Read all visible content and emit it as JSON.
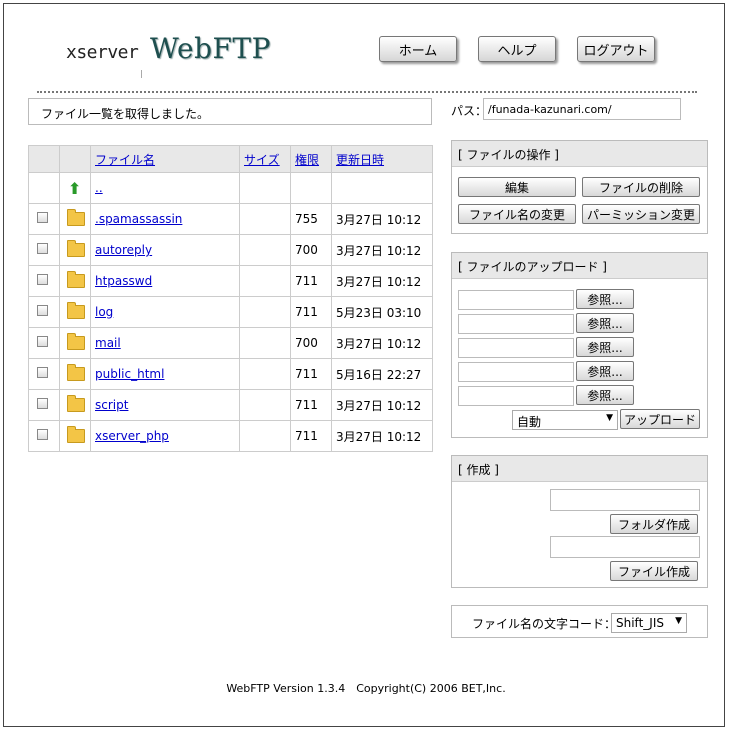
{
  "header": {
    "logo_prefix": "xserver",
    "logo_main": "WebFTP",
    "nav": [
      {
        "label": "ホーム"
      },
      {
        "label": "ヘルプ"
      },
      {
        "label": "ログアウト"
      }
    ]
  },
  "status_message": "ファイル一覧を取得しました。",
  "path": {
    "label": "パス：",
    "value": "/funada-kazunari.com/"
  },
  "file_table": {
    "columns": {
      "name": "ファイル名",
      "size": "サイズ",
      "perm": "権限",
      "date": "更新日時"
    },
    "parent": "..",
    "rows": [
      {
        "name": ".spamassassin",
        "size": "",
        "perm": "755",
        "date": "3月27日 10:12"
      },
      {
        "name": "autoreply",
        "size": "",
        "perm": "700",
        "date": "3月27日 10:12"
      },
      {
        "name": "htpasswd",
        "size": "",
        "perm": "711",
        "date": "3月27日 10:12"
      },
      {
        "name": "log",
        "size": "",
        "perm": "711",
        "date": "5月23日 03:10"
      },
      {
        "name": "mail",
        "size": "",
        "perm": "700",
        "date": "3月27日 10:12"
      },
      {
        "name": "public_html",
        "size": "",
        "perm": "711",
        "date": "5月16日 22:27"
      },
      {
        "name": "script",
        "size": "",
        "perm": "711",
        "date": "3月27日 10:12"
      },
      {
        "name": "xserver_php",
        "size": "",
        "perm": "711",
        "date": "3月27日 10:12"
      }
    ]
  },
  "ops_panel": {
    "title": "[ ファイルの操作 ]",
    "edit": "編集",
    "delete": "ファイルの削除",
    "rename": "ファイル名の変更",
    "chmod": "パーミッション変更"
  },
  "upload_panel": {
    "title": "[ ファイルのアップロード ]",
    "browse": "参照...",
    "mode": "自動",
    "upload": "アップロード"
  },
  "create_panel": {
    "title": "[ 作成 ]",
    "folder": "フォルダ作成",
    "file": "ファイル作成"
  },
  "encoding": {
    "label": "ファイル名の文字コード：",
    "value": "Shift_JIS"
  },
  "footer": "WebFTP Version 1.3.4　Copyright(C) 2006 BET,Inc."
}
